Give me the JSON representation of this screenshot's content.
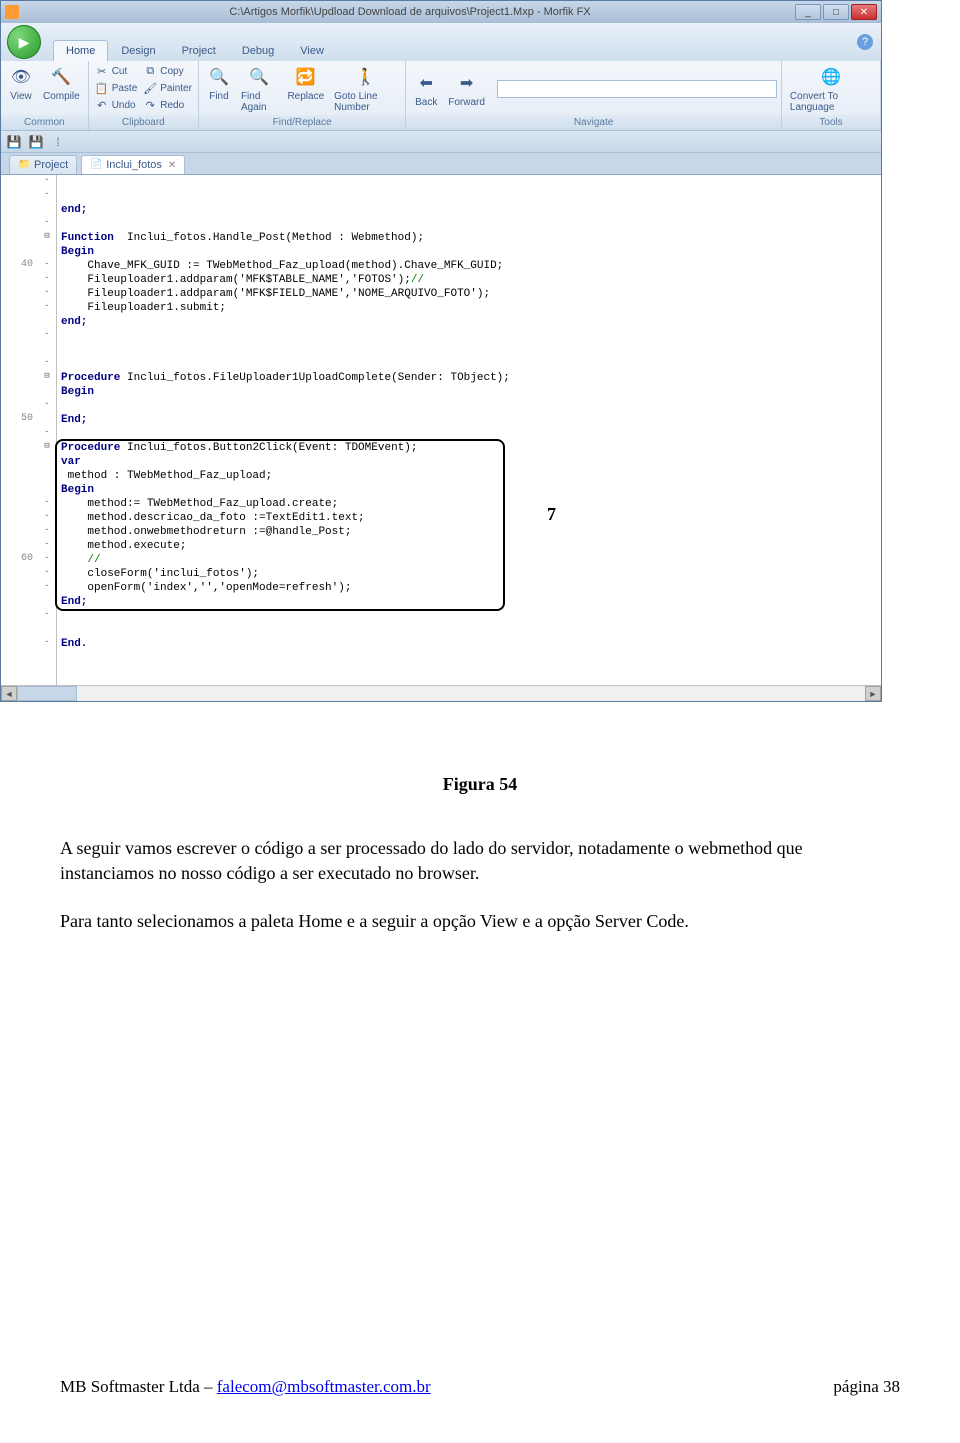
{
  "window": {
    "title": "C:\\Artigos Morfik\\Updload Download de arquivos\\Project1.Mxp - Morfik FX",
    "min": "_",
    "max": "□",
    "close": "✕"
  },
  "orb_glyph": "▶",
  "menu_tabs": [
    "Home",
    "Design",
    "Project",
    "Debug",
    "View"
  ],
  "help_glyph": "?",
  "ribbon": {
    "common": {
      "view": "View",
      "compile": "Compile",
      "label": "Common"
    },
    "clipboard": {
      "cut": "Cut",
      "copy": "Copy",
      "paste": "Paste",
      "painter": "Painter",
      "undo": "Undo",
      "redo": "Redo",
      "label": "Clipboard"
    },
    "findreplace": {
      "find": "Find",
      "find_again": "Find Again",
      "replace": "Replace",
      "goto": "Goto Line Number",
      "label": "Find/Replace"
    },
    "navigate": {
      "back": "Back",
      "forward": "Forward",
      "label": "Navigate"
    },
    "tools": {
      "convert": "Convert To Language",
      "label": "Tools"
    }
  },
  "qa": {
    "save_glyph": "💾",
    "sep_glyph": "⁞"
  },
  "doc_tabs": {
    "project": "Project",
    "active": "Inclui_fotos",
    "close": "✕"
  },
  "code": {
    "l1": "end;",
    "l2a": "Function",
    "l2b": "  Inclui_fotos.Handle_Post(Method : Webmethod);",
    "l3": "Begin",
    "l4": "    Chave_MFK_GUID := TWebMethod_Faz_upload(method).Chave_MFK_GUID;",
    "l5a": "    Fileuploader1.addparam('MFK$TABLE_NAME','FOTOS');",
    "l5b": "//",
    "l6": "    Fileuploader1.addparam('MFK$FIELD_NAME','NOME_ARQUIVO_FOTO');",
    "l7": "    Fileuploader1.submit;",
    "l8": "end;",
    "l9a": "Procedure",
    "l9b": " Inclui_fotos.FileUploader1UploadComplete(Sender: TObject);",
    "l10": "Begin",
    "l11": "End;",
    "l12a": "Procedure",
    "l12b": " Inclui_fotos.Button2Click(Event: TDOMEvent);",
    "l13": "var",
    "l14": " method : TWebMethod_Faz_upload;",
    "l15": "Begin",
    "l16": "    method:= TWebMethod_Faz_upload.create;",
    "l17": "    method.descricao_da_foto :=TextEdit1.text;",
    "l18": "    method.onwebmethodreturn :=@handle_Post;",
    "l19": "    method.execute;",
    "l20": "    //",
    "l21": "    closeForm('inclui_fotos');",
    "l22": "    openForm('index','','openMode=refresh');",
    "l23": "End;",
    "l24": "End.",
    "ln40": "40",
    "ln50": "50",
    "ln60": "60"
  },
  "annotation_7": "7",
  "doc": {
    "caption": "Figura 54",
    "p1": "A seguir vamos escrever o código a ser processado do lado do servidor, notadamente o webmethod que instanciamos no nosso código a ser executado no browser.",
    "p2": "Para tanto selecionamos a paleta  Home e a seguir a opção View e a opção Server Code."
  },
  "footer": {
    "left_prefix": "MB Softmaster Ltda – ",
    "email": "falecom@mbsoftmaster.com.br",
    "right_prefix": "página    ",
    "page": "38"
  }
}
